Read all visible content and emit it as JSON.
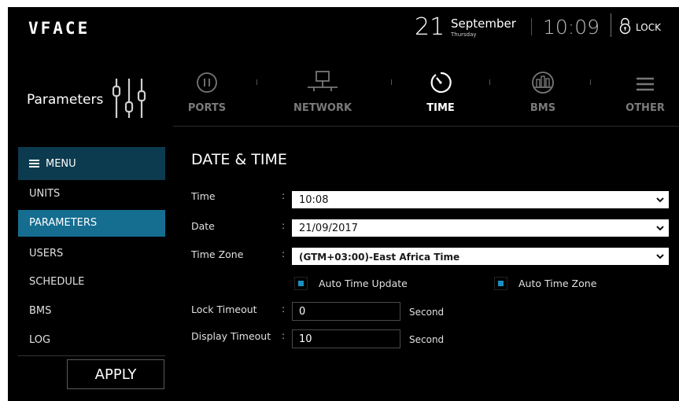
{
  "header": {
    "logo": "VFACE",
    "day": "21",
    "month": "September",
    "weekday": "Thursday",
    "clock": "10:09",
    "lock_label": "LOCK"
  },
  "page": {
    "title": "Parameters"
  },
  "tabs": [
    {
      "label": "PORTS",
      "icon": "ports-icon",
      "active": false
    },
    {
      "label": "NETWORK",
      "icon": "network-icon",
      "active": false
    },
    {
      "label": "TIME",
      "icon": "time-icon",
      "active": true
    },
    {
      "label": "BMS",
      "icon": "bms-icon",
      "active": false
    },
    {
      "label": "OTHER",
      "icon": "other-icon",
      "active": false
    }
  ],
  "sidebar": {
    "menu_label": "MENU",
    "items": [
      {
        "label": "UNITS"
      },
      {
        "label": "PARAMETERS",
        "active": true
      },
      {
        "label": "USERS"
      },
      {
        "label": "SCHEDULE"
      },
      {
        "label": "BMS"
      },
      {
        "label": "LOG"
      }
    ],
    "apply_label": "APPLY"
  },
  "form": {
    "section_title": "DATE & TIME",
    "time": {
      "label": "Time",
      "value": "10:08"
    },
    "date": {
      "label": "Date",
      "value": "21/09/2017"
    },
    "timezone": {
      "label": "Time Zone",
      "value": "(GTM+03:00)-East Africa Time"
    },
    "auto_time_update": {
      "label": "Auto Time Update",
      "checked": true
    },
    "auto_time_zone": {
      "label": "Auto Time Zone",
      "checked": true
    },
    "lock_timeout": {
      "label": "Lock Timeout",
      "value": "0",
      "unit": "Second"
    },
    "display_timeout": {
      "label": "Display Timeout",
      "value": "10",
      "unit": "Second"
    }
  },
  "colors": {
    "background": "#000000",
    "accent": "#156d90",
    "menu_header": "#0c3b4f",
    "checkbox": "#1b8fc0",
    "inactive_tab": "#7a7a7a"
  }
}
